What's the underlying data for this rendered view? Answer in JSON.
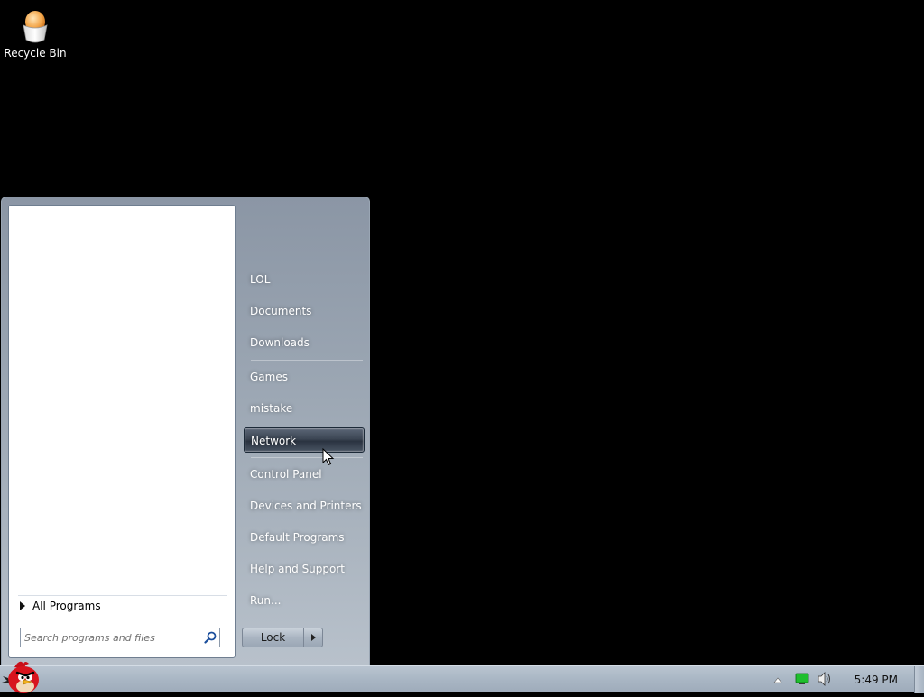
{
  "desktop": {
    "icons": [
      {
        "label": "Recycle Bin",
        "icon": "recycle-bin-icon"
      }
    ]
  },
  "start_menu": {
    "all_programs_label": "All Programs",
    "search_placeholder": "Search programs and files",
    "places": [
      {
        "label": "LOL"
      },
      {
        "label": "Documents"
      },
      {
        "label": "Downloads"
      },
      {
        "label": "Games"
      },
      {
        "label": "mistake"
      },
      {
        "label": "Network",
        "highlighted": true
      },
      {
        "label": "Control Panel"
      },
      {
        "label": "Devices and Printers"
      },
      {
        "label": "Default Programs"
      },
      {
        "label": "Help and Support"
      },
      {
        "label": "Run..."
      }
    ],
    "power_button_label": "Lock"
  },
  "taskbar": {
    "start_icon": "angry-bird-start-icon",
    "clock": "5:49 PM",
    "tray_icons": [
      "show-hidden-icons-icon",
      "network-status-icon",
      "volume-icon"
    ]
  }
}
